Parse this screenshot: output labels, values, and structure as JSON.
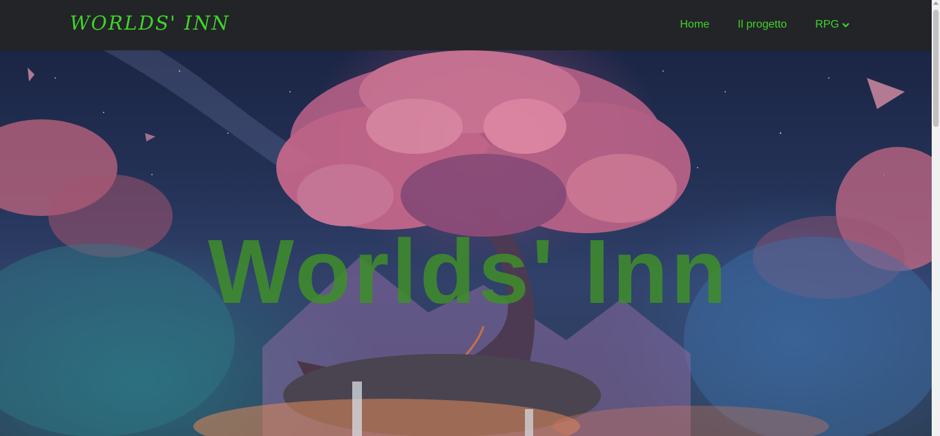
{
  "navbar": {
    "brand": "WORLDS' INN",
    "links": [
      {
        "label": "Home"
      },
      {
        "label": "Il progetto"
      },
      {
        "label": "RPG",
        "dropdown": true
      }
    ]
  },
  "hero": {
    "title": "Worlds' Inn",
    "background_description_icon": "fantasy-tree-image"
  },
  "colors": {
    "accent": "#3fd42a",
    "navbar_bg": "#232427",
    "hero_title": "#3f8e2a"
  }
}
